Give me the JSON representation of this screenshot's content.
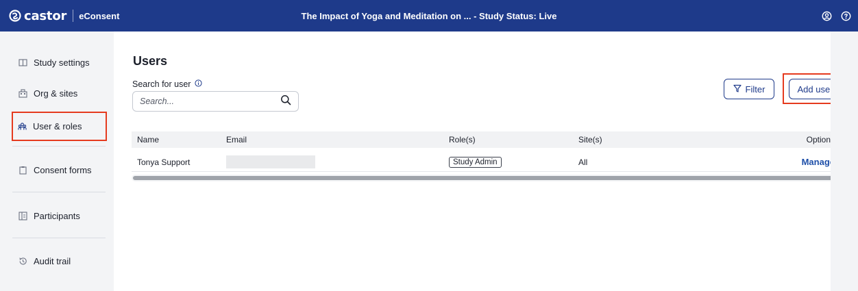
{
  "topbar": {
    "brand_name": "castor",
    "product_name": "eConsent",
    "study_title": "The Impact of Yoga and Meditation on ...  - Study Status: Live",
    "icons": [
      "user-circle-icon",
      "help-icon"
    ]
  },
  "sidebar": {
    "items": [
      {
        "label": "Study settings",
        "icon": "book-icon"
      },
      {
        "label": "Org & sites",
        "icon": "building-icon"
      },
      {
        "label": "User & roles",
        "icon": "users-icon",
        "active": true
      },
      {
        "label": "Consent forms",
        "icon": "clipboard-icon"
      },
      {
        "label": "Participants",
        "icon": "participants-icon"
      },
      {
        "label": "Audit trail",
        "icon": "history-icon"
      }
    ]
  },
  "main": {
    "title": "Users",
    "search": {
      "label": "Search for user",
      "placeholder": "Search..."
    },
    "filter_button": "Filter",
    "add_user_button": "Add user",
    "table": {
      "columns": [
        "Name",
        "Email",
        "Role(s)",
        "Site(s)",
        "Options"
      ],
      "rows": [
        {
          "name": "Tonya Support",
          "email": "",
          "role": "Study Admin",
          "sites": "All",
          "option": "Manage"
        }
      ]
    }
  },
  "colors": {
    "brand_navy": "#1e3a8a",
    "highlight_red": "#e53a1e",
    "sidebar_bg": "#f3f4f6",
    "link_blue": "#1e4fa8"
  }
}
